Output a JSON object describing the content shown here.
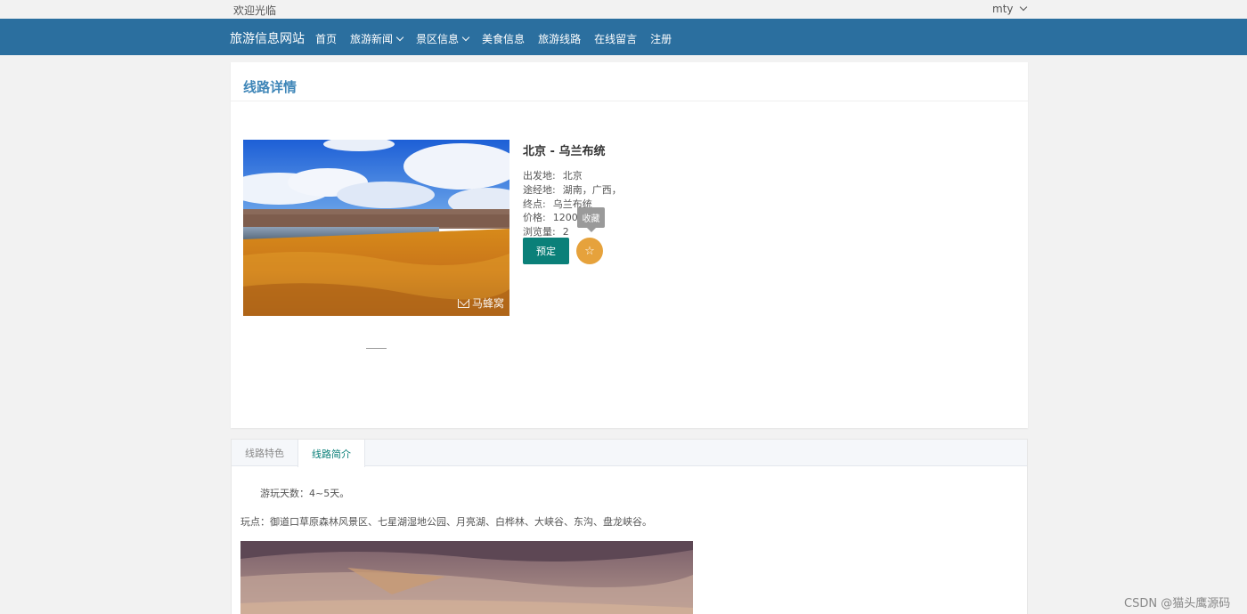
{
  "topbar": {
    "welcome": "欢迎光临",
    "username": "mty"
  },
  "navbar": {
    "brand": "旅游信息网站",
    "menu": [
      {
        "label": "首页",
        "has_dropdown": false
      },
      {
        "label": "旅游新闻",
        "has_dropdown": true
      },
      {
        "label": "景区信息",
        "has_dropdown": true
      },
      {
        "label": "美食信息",
        "has_dropdown": false
      },
      {
        "label": "旅游线路",
        "has_dropdown": false
      },
      {
        "label": "在线留言",
        "has_dropdown": false
      },
      {
        "label": "注册",
        "has_dropdown": false
      }
    ],
    "bg_color": "#2b6f9f"
  },
  "detail": {
    "section_title": "线路详情",
    "route_title": "北京 - 乌兰布统",
    "fields": [
      {
        "label": "出发地:",
        "value": "北京"
      },
      {
        "label": "途经地:",
        "value": "湖南，广西，"
      },
      {
        "label": "终点:",
        "value": "乌兰布统"
      },
      {
        "label": "价格:",
        "value": "1200"
      },
      {
        "label": "浏览量:",
        "value": "2"
      }
    ],
    "book_label": "预定",
    "favorite_tooltip": "收藏",
    "photo_watermark": "马蜂窝",
    "book_color": "#0b8079",
    "favorite_color": "#e6a23c"
  },
  "tabs": {
    "items": [
      {
        "label": "线路特色",
        "active": false
      },
      {
        "label": "线路简介",
        "active": true
      }
    ],
    "content": {
      "line1": "游玩天数：4~5天。",
      "line2": "玩点：御道口草原森林风景区、七星湖湿地公园、月亮湖、白桦林、大峡谷、东沟、盘龙峡谷。"
    }
  },
  "page_watermark": "CSDN @猫头鹰源码"
}
